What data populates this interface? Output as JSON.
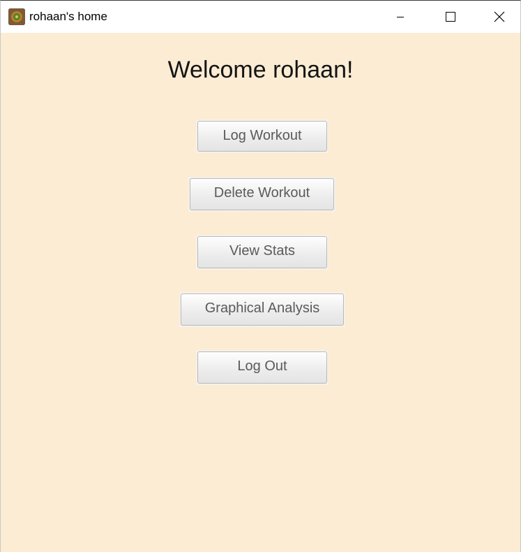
{
  "window": {
    "title": "rohaan's home",
    "controls": [
      "minimize-icon",
      "maximize-icon",
      "close-icon"
    ]
  },
  "main": {
    "welcome_text": "Welcome rohaan!",
    "buttons": [
      {
        "label": "Log Workout"
      },
      {
        "label": "Delete Workout"
      },
      {
        "label": "View Stats"
      },
      {
        "label": "Graphical Analysis"
      },
      {
        "label": "Log Out"
      }
    ]
  },
  "colors": {
    "background": "#fbecd3",
    "titlebar": "#ffffff",
    "button_text": "#5a5a5a",
    "heading_text": "#141414"
  }
}
